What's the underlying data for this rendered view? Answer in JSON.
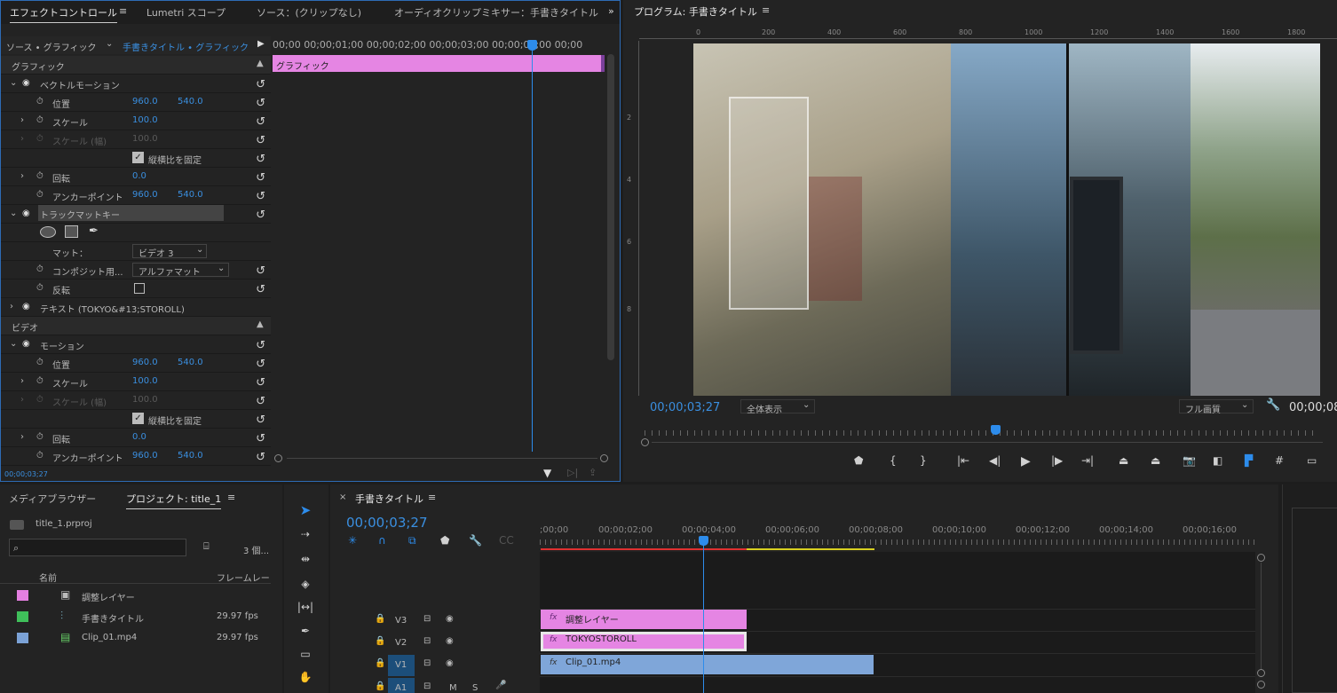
{
  "effect_controls": {
    "tabs": [
      "エフェクトコントロール",
      "Lumetri スコープ",
      "ソース：(クリップなし)",
      "オーディオクリップミキサー：手書きタイトル"
    ],
    "menu_glyph": "≡",
    "overflow_glyph": "»",
    "source_label": "ソース • グラフィック",
    "sequence_label": "手書きタイトル • グラフィック",
    "timecodes": "00;00 00;00;01;00 00;00;02;00 00;00;03;00 00;00;04;00 00;00",
    "graphic_bar_label": "グラフィック",
    "current_time": "00;00;03;27",
    "sections": {
      "graphic": "グラフィック",
      "video": "ビデオ"
    },
    "vector_motion": {
      "label": "ベクトルモーション",
      "position": {
        "label": "位置",
        "x": "960.0",
        "y": "540.0"
      },
      "scale": {
        "label": "スケール",
        "value": "100.0"
      },
      "scale_w": {
        "label": "スケール (幅)",
        "value": "100.0"
      },
      "uniform_scale": "縦横比を固定",
      "rotation": {
        "label": "回転",
        "value": "0.0"
      },
      "anchor": {
        "label": "アンカーポイント",
        "x": "960.0",
        "y": "540.0"
      }
    },
    "track_matte": {
      "label": "トラックマットキー",
      "matte_label": "マット：",
      "matte_value": "ビデオ 3",
      "composite_label": "コンポジット用...",
      "composite_value": "アルファマット",
      "reverse_label": "反転"
    },
    "text_layer": "テキスト (TOKYO&#13;STOROLL)",
    "motion": {
      "label": "モーション",
      "position": {
        "label": "位置",
        "x": "960.0",
        "y": "540.0"
      },
      "scale": {
        "label": "スケール",
        "value": "100.0"
      },
      "scale_w": {
        "label": "スケール (幅)",
        "value": "100.0"
      },
      "uniform_scale": "縦横比を固定",
      "rotation": {
        "label": "回転",
        "value": "0.0"
      },
      "anchor": {
        "label": "アンカーポイント",
        "x": "960.0",
        "y": "540.0"
      }
    }
  },
  "program": {
    "title": "プログラム: 手書きタイトル",
    "menu_glyph": "≡",
    "ruler": [
      "0",
      "200",
      "400",
      "600",
      "800",
      "1000",
      "1200",
      "1400",
      "1600",
      "1800"
    ],
    "vruler": [
      "2",
      "4",
      "6",
      "8"
    ],
    "timecode": "00;00;03;27",
    "zoom": "全体表示",
    "quality": "フル画質",
    "end_timecode": "00;00;08"
  },
  "project": {
    "tabs": [
      "メディアブラウザー",
      "プロジェクト: title_1"
    ],
    "menu_glyph": "≡",
    "file": "title_1.prproj",
    "items_count": "3 個...",
    "columns": [
      "名前",
      "フレームレー"
    ],
    "items": [
      {
        "name": "調整レイヤー",
        "fps": "",
        "color": "#e47fe0"
      },
      {
        "name": "手書きタイトル",
        "fps": "29.97 fps",
        "color": "#3fbf5a"
      },
      {
        "name": "Clip_01.mp4",
        "fps": "29.97 fps",
        "color": "#7ba2d6"
      }
    ]
  },
  "timeline": {
    "close": "×",
    "title": "手書きタイトル",
    "menu_glyph": "≡",
    "timecode": "00;00;03;27",
    "ruler": [
      ";00;00",
      "00;00;02;00",
      "00;00;04;00",
      "00;00;06;00",
      "00;00;08;00",
      "00;00;10;00",
      "00;00;12;00",
      "00;00;14;00",
      "00;00;16;00"
    ],
    "tracks": [
      "V3",
      "V2",
      "V1",
      "A1"
    ],
    "track_m": "M",
    "track_s": "S",
    "clips": {
      "v3": "調整レイヤー",
      "v2": "TOKYOSTOROLL",
      "v1": "Clip_01.mp4"
    },
    "fx": "fx"
  },
  "colors": {
    "accent": "#2d8ceb",
    "graphic_clip": "#e585e3",
    "video_clip": "#7fa6d9"
  }
}
